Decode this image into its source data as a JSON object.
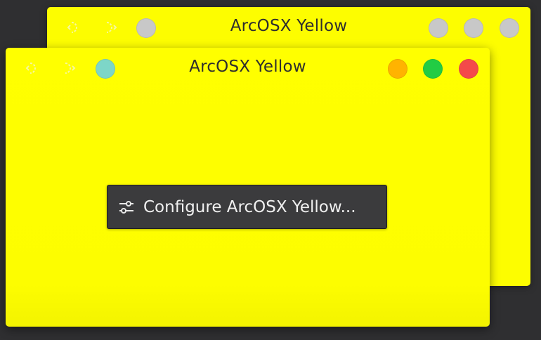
{
  "back_window": {
    "title": "ArcOSX Yellow",
    "buttons": {
      "menu_color": "#c8c8c8",
      "minimize_color": "#c8c8c8",
      "maximize_color": "#c8c8c8",
      "close_color": "#c8c8c8"
    },
    "ghost_icons": [
      "keep-above-icon",
      "keep-below-icon"
    ]
  },
  "front_window": {
    "title": "ArcOSX Yellow",
    "buttons": {
      "menu_color": "#7dd6c8",
      "minimize_color": "#ffb300",
      "maximize_color": "#22cc44",
      "close_color": "#f44a4a"
    },
    "ghost_icons": [
      "keep-above-icon",
      "keep-below-icon"
    ],
    "configure_button": {
      "label": "Configure ArcOSX Yellow...",
      "icon": "sliders-icon"
    }
  },
  "colors": {
    "window_background": "#fdfd00",
    "desktop_background": "#2f2f31",
    "button_background": "#3b3b3d"
  }
}
